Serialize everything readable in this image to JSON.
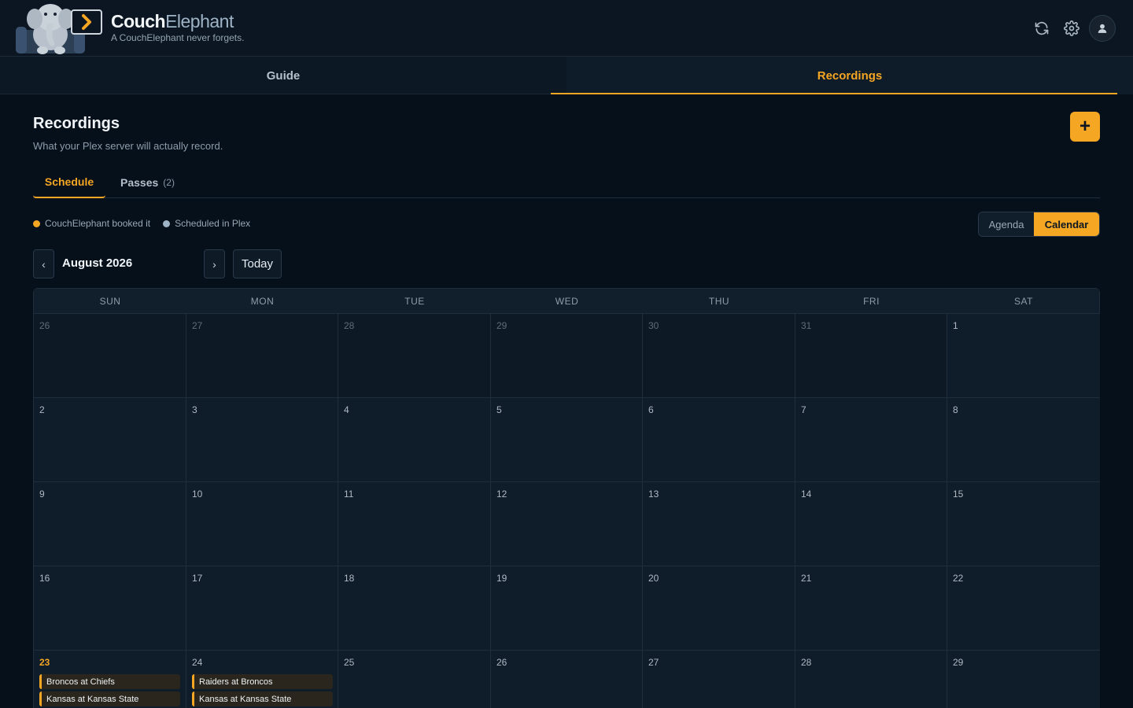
{
  "app": {
    "name_part1": "Couch",
    "name_part2": "Elephant",
    "tagline": "A CouchElephant never forgets."
  },
  "header_icons": [
    "refresh-icon",
    "gear-icon",
    "user-icon"
  ],
  "main_tabs": [
    {
      "label": "Guide",
      "active": false
    },
    {
      "label": "Recordings",
      "active": true
    }
  ],
  "page": {
    "title": "Recordings",
    "subtitle": "What your Plex server will actually record.",
    "add_label": "+"
  },
  "sub_tabs": [
    {
      "label": "Schedule",
      "active": true
    },
    {
      "label": "Passes",
      "count": "(2)",
      "active": false
    }
  ],
  "legend": [
    {
      "label": "CouchElephant booked it",
      "color": "#f5a623"
    },
    {
      "label": "Scheduled in Plex",
      "color": "#9fb3c6"
    }
  ],
  "view_toggle": {
    "agenda": "Agenda",
    "calendar": "Calendar",
    "selected": "Calendar"
  },
  "nav": {
    "prev": "‹",
    "next": "›",
    "month": "August 2026",
    "today": "Today"
  },
  "colors": {
    "accent": "#f5a623",
    "background": "#06101a"
  },
  "calendar": {
    "days_of_week": [
      "SUN",
      "MON",
      "TUE",
      "WED",
      "THU",
      "FRI",
      "SAT"
    ],
    "weeks": [
      [
        {
          "d": "26",
          "out": true
        },
        {
          "d": "27",
          "out": true
        },
        {
          "d": "28",
          "out": true
        },
        {
          "d": "29",
          "out": true
        },
        {
          "d": "30",
          "out": true
        },
        {
          "d": "31",
          "out": true
        },
        {
          "d": "1"
        }
      ],
      [
        {
          "d": "2"
        },
        {
          "d": "3"
        },
        {
          "d": "4"
        },
        {
          "d": "5"
        },
        {
          "d": "6"
        },
        {
          "d": "7"
        },
        {
          "d": "8"
        }
      ],
      [
        {
          "d": "9"
        },
        {
          "d": "10"
        },
        {
          "d": "11"
        },
        {
          "d": "12"
        },
        {
          "d": "13"
        },
        {
          "d": "14"
        },
        {
          "d": "15"
        }
      ],
      [
        {
          "d": "16"
        },
        {
          "d": "17"
        },
        {
          "d": "18"
        },
        {
          "d": "19"
        },
        {
          "d": "20"
        },
        {
          "d": "21"
        },
        {
          "d": "22"
        }
      ],
      [
        {
          "d": "23",
          "today": true,
          "events": [
            "Broncos at Chiefs",
            "Kansas at Kansas State"
          ]
        },
        {
          "d": "24",
          "events": [
            "Raiders at Broncos",
            "Kansas at Kansas State"
          ]
        },
        {
          "d": "25"
        },
        {
          "d": "26"
        },
        {
          "d": "27"
        },
        {
          "d": "28"
        },
        {
          "d": "29"
        }
      ]
    ]
  }
}
